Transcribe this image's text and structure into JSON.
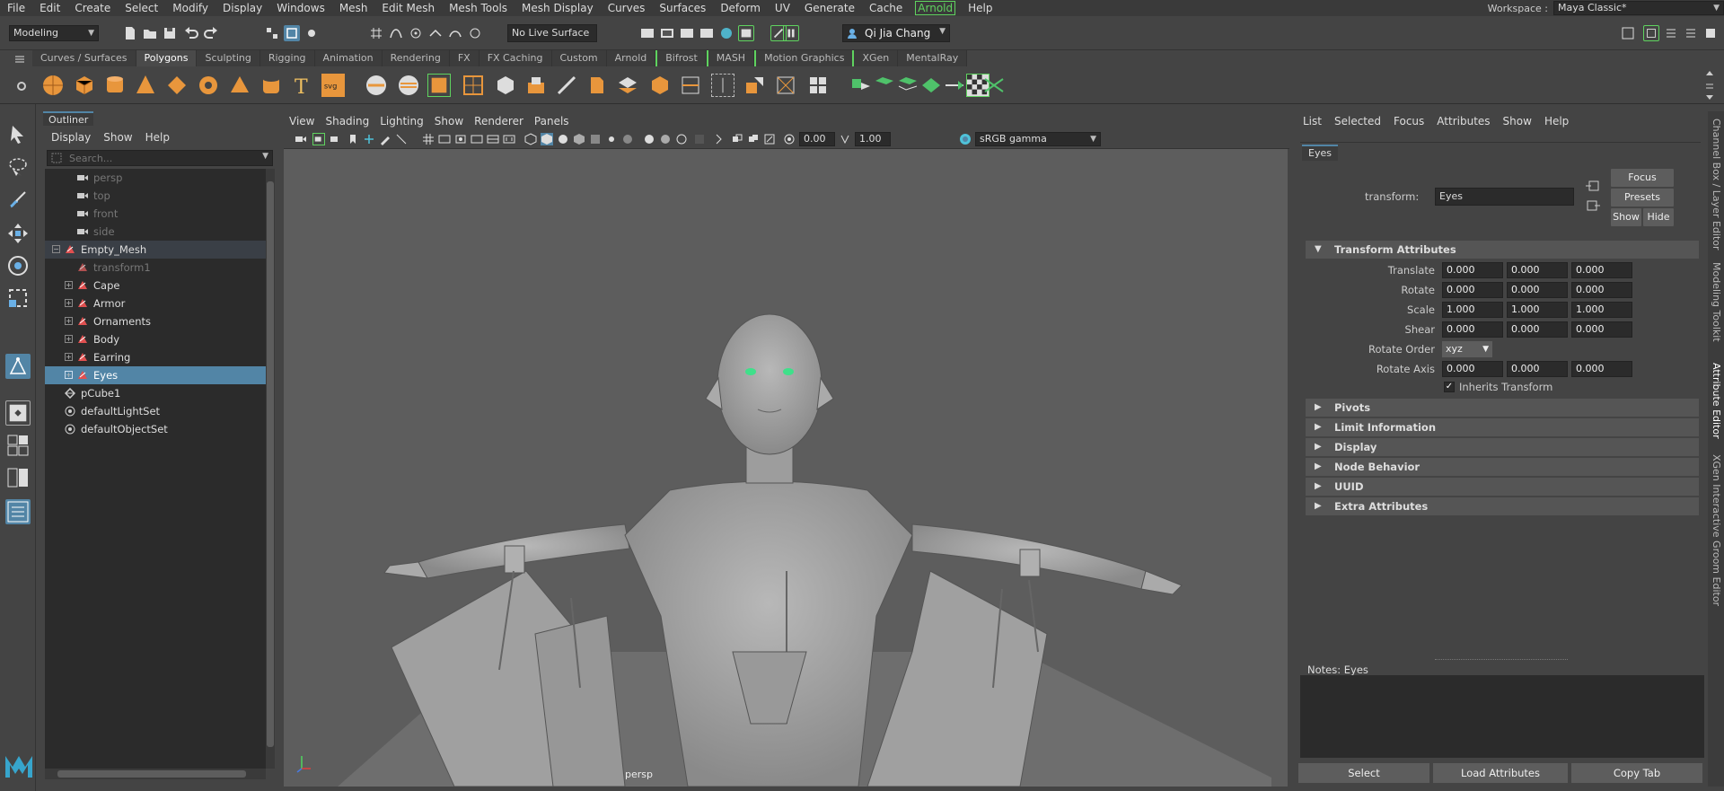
{
  "menubar": {
    "items": [
      "File",
      "Edit",
      "Create",
      "Select",
      "Modify",
      "Display",
      "Windows",
      "Mesh",
      "Edit Mesh",
      "Mesh Tools",
      "Mesh Display",
      "Curves",
      "Surfaces",
      "Deform",
      "UV",
      "Generate",
      "Cache",
      "Arnold",
      "Help"
    ],
    "workspace_label": "Workspace :",
    "workspace_value": "Maya Classic*"
  },
  "statusline": {
    "mode": "Modeling",
    "live_surface": "No Live Surface",
    "user": "Qi Jia Chang"
  },
  "shelf_tabs": [
    "Curves / Surfaces",
    "Polygons",
    "Sculpting",
    "Rigging",
    "Animation",
    "Rendering",
    "FX",
    "FX Caching",
    "Custom",
    "Arnold",
    "Bifrost",
    "MASH",
    "Motion Graphics",
    "XGen",
    "MentalRay"
  ],
  "shelf_active": "Polygons",
  "outliner": {
    "title": "Outliner",
    "menu": [
      "Display",
      "Show",
      "Help"
    ],
    "search_placeholder": "Search...",
    "rows": [
      {
        "label": "persp",
        "icon": "camera-icon",
        "indent": 1,
        "dim": true
      },
      {
        "label": "top",
        "icon": "camera-icon",
        "indent": 1,
        "dim": true
      },
      {
        "label": "front",
        "icon": "camera-icon",
        "indent": 1,
        "dim": true
      },
      {
        "label": "side",
        "icon": "camera-icon",
        "indent": 1,
        "dim": true
      },
      {
        "label": "Empty_Mesh",
        "icon": "mesh-icon",
        "indent": 0,
        "expand": "-",
        "highlight": true
      },
      {
        "label": "transform1",
        "icon": "mesh-icon",
        "indent": 1,
        "dim": true
      },
      {
        "label": "Cape",
        "icon": "mesh-icon",
        "indent": 1,
        "expand": "+"
      },
      {
        "label": "Armor",
        "icon": "mesh-icon",
        "indent": 1,
        "expand": "+"
      },
      {
        "label": "Ornaments",
        "icon": "mesh-icon",
        "indent": 1,
        "expand": "+"
      },
      {
        "label": "Body",
        "icon": "mesh-icon",
        "indent": 1,
        "expand": "+"
      },
      {
        "label": "Earring",
        "icon": "mesh-icon",
        "indent": 1,
        "expand": "+"
      },
      {
        "label": "Eyes",
        "icon": "mesh-icon",
        "indent": 1,
        "expand": "+",
        "selected": true
      },
      {
        "label": "pCube1",
        "icon": "transform-icon",
        "indent": 0
      },
      {
        "label": "defaultLightSet",
        "icon": "set-icon",
        "indent": 0
      },
      {
        "label": "defaultObjectSet",
        "icon": "set-icon",
        "indent": 0
      }
    ]
  },
  "viewport": {
    "menu": [
      "View",
      "Shading",
      "Lighting",
      "Show",
      "Renderer",
      "Panels"
    ],
    "exposure": "0.00",
    "gamma": "1.00",
    "color_space": "sRGB gamma",
    "camera_label": "persp"
  },
  "attribute_editor": {
    "menu": [
      "List",
      "Selected",
      "Focus",
      "Attributes",
      "Show",
      "Help"
    ],
    "tab": "Eyes",
    "transform_label": "transform:",
    "transform_value": "Eyes",
    "focus_btn": "Focus",
    "presets_btn": "Presets",
    "show_btn": "Show",
    "hide_btn": "Hide",
    "transform_section": "Transform Attributes",
    "attrs": [
      {
        "label": "Translate",
        "values": [
          "0.000",
          "0.000",
          "0.000"
        ]
      },
      {
        "label": "Rotate",
        "values": [
          "0.000",
          "0.000",
          "0.000"
        ]
      },
      {
        "label": "Scale",
        "values": [
          "1.000",
          "1.000",
          "1.000"
        ]
      },
      {
        "label": "Shear",
        "values": [
          "0.000",
          "0.000",
          "0.000"
        ]
      }
    ],
    "rotate_order_label": "Rotate Order",
    "rotate_order_value": "xyz",
    "rotate_axis": {
      "label": "Rotate Axis",
      "values": [
        "0.000",
        "0.000",
        "0.000"
      ]
    },
    "inherits_transform": "Inherits Transform",
    "collapsed_sections": [
      "Pivots",
      "Limit Information",
      "Display",
      "Node Behavior",
      "UUID",
      "Extra Attributes"
    ],
    "notes_label": "Notes:  Eyes",
    "bottom_buttons": [
      "Select",
      "Load Attributes",
      "Copy Tab"
    ]
  },
  "side_tabs": [
    "Channel Box / Layer Editor",
    "Modeling Toolkit",
    "Attribute Editor",
    "XGen Interactive Groom Editor"
  ],
  "colors": {
    "accent": "#5285a6",
    "arnold_green": "#5fd35f",
    "viewport_bg": "#5d5d5d",
    "eye_glow": "#3fe08a"
  }
}
